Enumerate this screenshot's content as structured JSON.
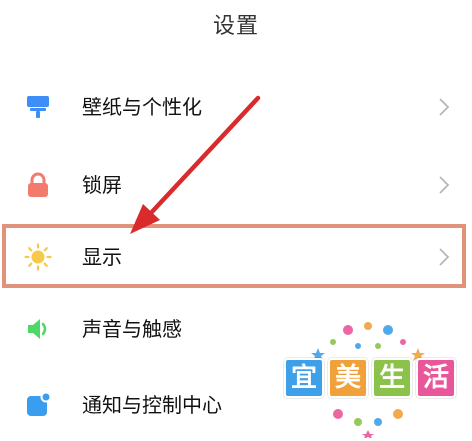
{
  "header": {
    "title": "设置"
  },
  "settings": {
    "items": [
      {
        "label": "壁纸与个性化",
        "icon": "wallpaper-icon",
        "color": "#3e8ef7"
      },
      {
        "label": "锁屏",
        "icon": "lock-icon",
        "color": "#f37b6e"
      },
      {
        "label": "显示",
        "icon": "brightness-icon",
        "color": "#f7c948"
      },
      {
        "label": "声音与触感",
        "icon": "speaker-icon",
        "color": "#4cd964"
      },
      {
        "label": "通知与控制中心",
        "icon": "notification-icon",
        "color": "#3a9ef0"
      }
    ]
  },
  "annotation": {
    "highlight_color": "#e0927a",
    "arrow_color": "#d92b2b"
  },
  "watermark": {
    "chars": [
      "宜",
      "美",
      "生",
      "活"
    ],
    "colors": [
      "#3ea0e8",
      "#f0a13a",
      "#8bc34a",
      "#e9569a"
    ]
  }
}
